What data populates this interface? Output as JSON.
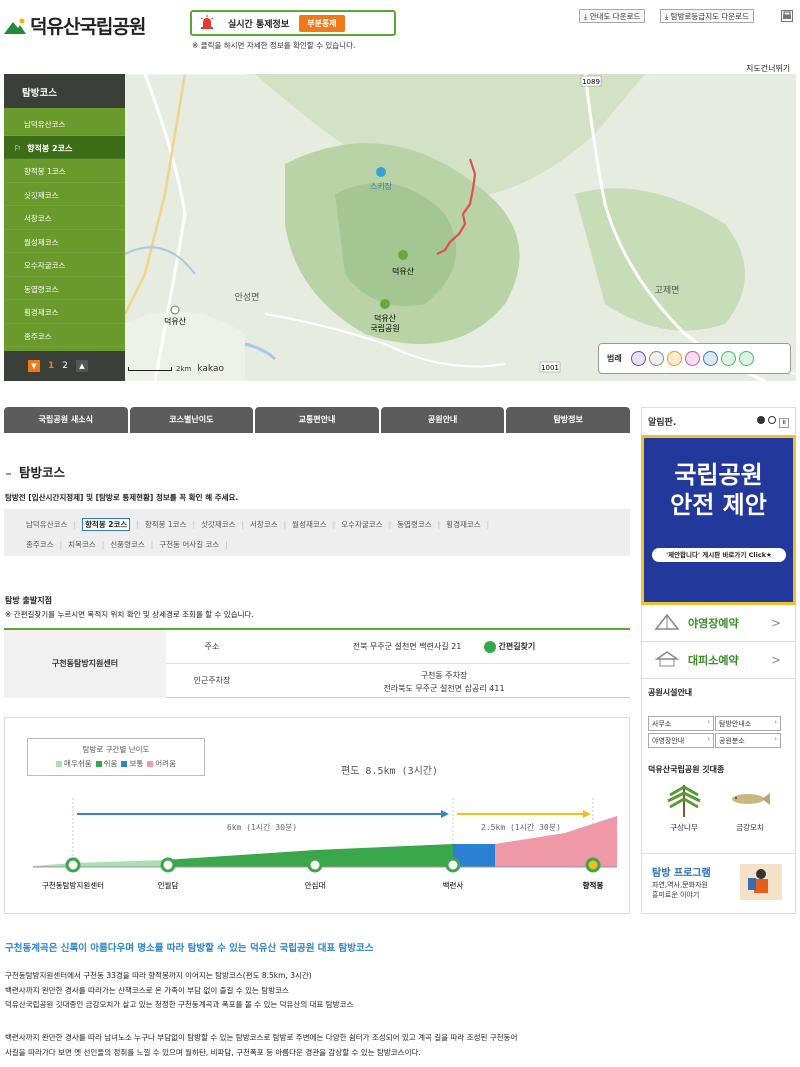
{
  "header": {
    "logo_text": "덕유산국립공원",
    "alert_label": "실시간 통제정보",
    "alert_status": "부분통제",
    "alert_note": "※ 클릭을 하시면 자세한 정보를 확인할 수 있습니다.",
    "guide_download": "⤓ 안내도 다운로드",
    "grade_download": "⤓ 탐방로등급지도 다운로드",
    "map_toggle": "지도건너뛰기"
  },
  "sidebar": {
    "title": "탐방코스",
    "items": [
      {
        "label": "남덕유산코스"
      },
      {
        "label": "향적봉 2코스",
        "active": true
      },
      {
        "label": "향적봉 1코스"
      },
      {
        "label": "삿갓재코스"
      },
      {
        "label": "서창코스"
      },
      {
        "label": "월성재코스"
      },
      {
        "label": "오수자굴코스"
      },
      {
        "label": "동엽령코스"
      },
      {
        "label": "횡경재코스"
      },
      {
        "label": "종주코스"
      }
    ],
    "pages": [
      "1",
      "2"
    ]
  },
  "map": {
    "labels": {
      "ski": "스키장",
      "peak": "덕유산",
      "park": "덕유산\n국립공원",
      "anseong": "안성면",
      "gojae": "고제면",
      "ic": "덕유산",
      "road1089": "1089",
      "road1001": "1001"
    },
    "legend_title": "범례",
    "legend_colors": [
      "#6a4fb8",
      "#8a8a8a",
      "#e0a030",
      "#d34fa8",
      "#3a7ad8",
      "#4ab86a",
      "#4ab86a"
    ],
    "scale_label": "2km",
    "brand": "kakao"
  },
  "tabs": [
    "국립공원 새소식",
    "코스별난이도",
    "교통편안내",
    "공원안내",
    "탐방정보"
  ],
  "section": {
    "title": "탐방코스",
    "note": "탐방전 [입산시간지정제] 및 [탐방로 통제현황] 정보를 꼭 확인 해 주세요.",
    "courses": [
      "남덕유산코스",
      "향적봉 2코스",
      "향적봉 1코스",
      "삿갓재코스",
      "서창코스",
      "월성재코스",
      "오수자굴코스",
      "동엽령코스",
      "횡경재코스",
      "종주코스",
      "치목코스",
      "신풍령코스",
      "구천동 어사길 코스"
    ],
    "selected_course": "향적봉 2코스"
  },
  "start": {
    "heading": "탐방 출발지점",
    "note": "※ 간편길찾기를 누르시면 목적지 위치 확인 및 상세경로 조회를 할 수 있습니다.",
    "center": "구천동탐방지원센터",
    "addr_label": "주소",
    "addr_value": "전북 무주군 설천면 백련사길 21",
    "nav_label": "간편길찾기",
    "park_label": "인근주차장",
    "park_name": "구천동 주차장",
    "park_addr": "전라북도 무주군 설천면 삼공리 411"
  },
  "elevation": {
    "legend_title": "탐방로 구간별 난이도",
    "legend_items": [
      {
        "label": "매우쉬움",
        "color": "#a8e0b0"
      },
      {
        "label": "쉬움",
        "color": "#3aa84a"
      },
      {
        "label": "보통",
        "color": "#2b7fd4"
      },
      {
        "label": "어려움",
        "color": "#ee98a8"
      }
    ],
    "total": "편도 8.5km (3시간)",
    "seg1": "6km (1시간 30분)",
    "seg2": "2.5km (1시간 30분)",
    "points": [
      "구천동탐방지원센터",
      "인월담",
      "안심대",
      "백련사",
      "향적봉"
    ]
  },
  "description": {
    "heading": "구천동계곡은 신록이 아름다우며 명소를 따라 탐방할 수 있는 덕유산 국립공원 대표 탐방코스",
    "lines": [
      "구천동탐방지원센터에서 구천동 33경을 따라 향적봉까지 이어지는 탐방코스(편도 8.5km, 3시간)",
      "백련사까지 완만한 경사를 따라가는 산책코스로 온 가족이 부담 없이 즐길 수 있는 탐방코스",
      "덕유산국립공원 깃대종인 금강모치가 살고 있는 청정한 구천동계곡과 폭포를 볼 수 있는 덕유산의 대표 탐방코스"
    ],
    "para2": [
      "백련사까지 완만한 경사를 따라 남녀노소 누구나 부담없이 탐방할 수 있는 탐방코스로 탐방로 주변에는 다양한 쉼터가 조성되어 있고 계곡 길을 따라 조성된 구천동어",
      "사길을 따라가다 보면 옛 선인들의 정취를 느낄 수 있으며 월하탄, 비파담, 구천폭포 등 아름다운 경관을 감상할 수 있는 탐방코스이다."
    ]
  },
  "right": {
    "notice_title": "알림판.",
    "banner_line1": "국립공원",
    "banner_line2": "안전 제안",
    "banner_click": "'제안합니다' 게시판 바로가기 Click★",
    "camp": "야영장예약",
    "shelter": "대피소예약",
    "facility_title": "공원시설안내",
    "facility_buttons": [
      "사무소",
      "탐방안내소",
      "야영장안내",
      "공원분소"
    ],
    "flag_title": "덕유산국립공원 깃대종",
    "flag_items": [
      "구상나무",
      "금강모치"
    ],
    "program_title": "탐방 프로그램",
    "program_sub": "자연,역사,문화자원\n흥미로운 이야기"
  }
}
